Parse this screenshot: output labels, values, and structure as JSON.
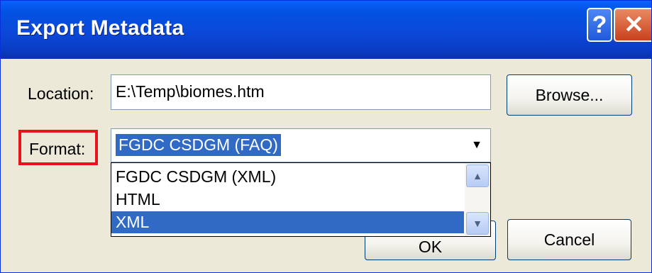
{
  "window": {
    "title": "Export Metadata"
  },
  "titlebar": {
    "help_label": "?",
    "close_label": "✕"
  },
  "location": {
    "label": "Location:",
    "value": "E:\\Temp\\biomes.htm"
  },
  "browse": {
    "label": "Browse..."
  },
  "format": {
    "label": "Format:",
    "selected": "FGDC CSDGM (FAQ)",
    "options": [
      "FGDC CSDGM (XML)",
      "HTML",
      "XML"
    ],
    "highlighted_option": "XML"
  },
  "buttons": {
    "ok_label": "OK",
    "cancel_label": "Cancel"
  },
  "icons": {
    "combo_arrow": "▼",
    "scroll_up": "▲",
    "scroll_down": "▼"
  },
  "colors": {
    "title_bar": "#0a4ad8",
    "selection": "#316ac5",
    "highlight_border": "#e8141c"
  }
}
